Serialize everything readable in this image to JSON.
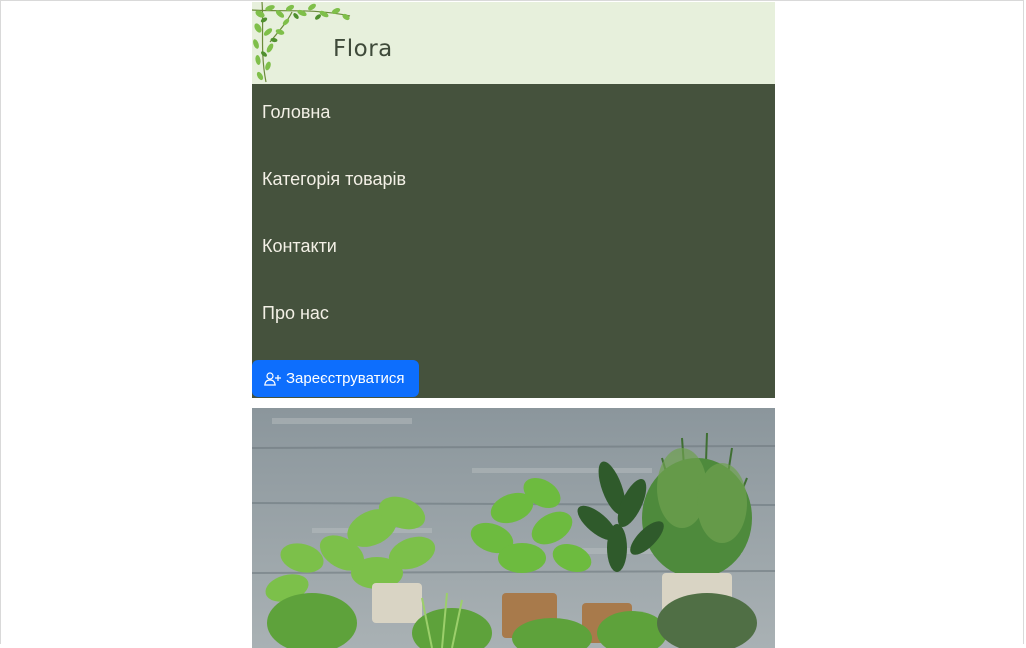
{
  "header": {
    "brand": "Flora"
  },
  "nav": {
    "items": [
      {
        "label": "Головна"
      },
      {
        "label": "Категорія товарів"
      },
      {
        "label": "Контакти"
      },
      {
        "label": "Про нас"
      }
    ],
    "register_label": "Зареєструватися",
    "register_icon": "user-plus-icon"
  },
  "colors": {
    "header_bg": "#e7f0dc",
    "nav_bg": "#45523d",
    "nav_text": "#f3f0e6",
    "button_bg": "#0d6efd"
  }
}
